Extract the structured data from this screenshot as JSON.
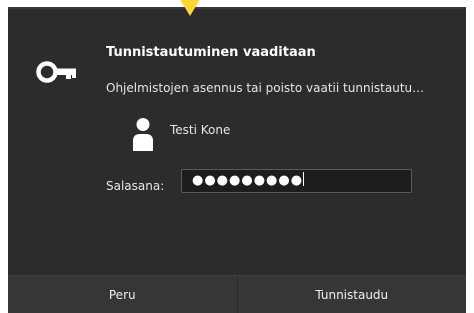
{
  "dialog": {
    "title": "Tunnistautuminen vaaditaan",
    "message": "Ohjelmistojen asennus tai poisto vaatii tunnistautu…",
    "user": {
      "name": "Testi Kone",
      "icon": "user-icon"
    },
    "auth_icon": "key-icon",
    "password": {
      "label": "Salasana:",
      "value_masked": "●●●●●●●●●"
    },
    "buttons": {
      "cancel": "Peru",
      "authenticate": "Tunnistaudu"
    }
  },
  "annotation": {
    "pointer_color": "#ffd633"
  },
  "colors": {
    "dialog_background": "#2c2c2c",
    "button_background": "#363636",
    "text": "#ffffff"
  }
}
